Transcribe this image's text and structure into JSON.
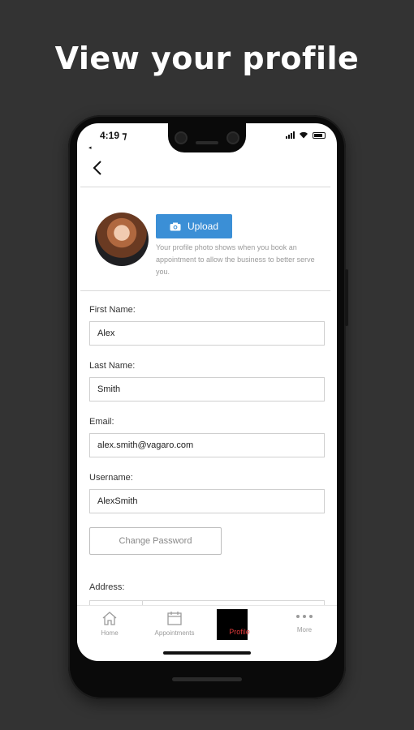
{
  "promo": {
    "headline": "View your profile"
  },
  "status_bar": {
    "time": "4:19 ⁊",
    "back_label": "◂"
  },
  "profile": {
    "upload_label": "Upload",
    "photo_note": "Your profile photo shows when you book an appointment to allow the business to better serve you."
  },
  "form": {
    "first_name": {
      "label": "First Name:",
      "value": "Alex"
    },
    "last_name": {
      "label": "Last Name:",
      "value": "Smith"
    },
    "email": {
      "label": "Email:",
      "value": "alex.smith@vagaro.com"
    },
    "username": {
      "label": "Username:",
      "value": "AlexSmith"
    },
    "change_password_label": "Change Password",
    "address_label": "Address:"
  },
  "tabs": [
    {
      "label": "Home",
      "icon": "home-icon"
    },
    {
      "label": "Appointments",
      "icon": "calendar-icon"
    },
    {
      "label": "Profile",
      "icon": "profile-icon",
      "active": true
    },
    {
      "label": "More",
      "icon": "more-dots-icon"
    }
  ],
  "colors": {
    "accent": "#3b8fd6",
    "active_tab_text": "#e23a3a",
    "background": "#333333"
  }
}
